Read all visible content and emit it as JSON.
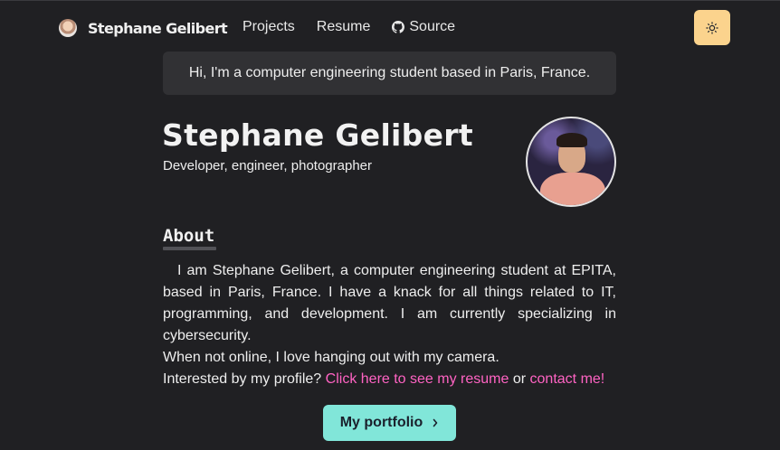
{
  "header": {
    "brand_name": "Stephane Gelibert",
    "nav": {
      "projects": "Projects",
      "resume": "Resume",
      "source": "Source"
    },
    "theme_toggle_icon": "sun-icon"
  },
  "greeting": "Hi, I'm a computer engineering student based in Paris, France.",
  "hero": {
    "name": "Stephane Gelibert",
    "tagline": "Developer, engineer, photographer"
  },
  "about": {
    "heading": "About",
    "paragraph": "I am Stephane Gelibert, a computer engineering student at EPITA, based in Paris, France. I have a knack for all things related to IT, programming, and development. I am currently specializing in cybersecurity.",
    "line2": "When not online, I love hanging out with my camera.",
    "line3_prefix": "Interested by my profile?",
    "resume_link": "Click here to see my resume",
    "or_text": "or",
    "contact_link": "contact me!"
  },
  "portfolio_button": "My portfolio",
  "colors": {
    "background": "#202023",
    "accent_button": "#81e6d9",
    "theme_button": "#fbd38d",
    "link": "#ff63c3"
  }
}
